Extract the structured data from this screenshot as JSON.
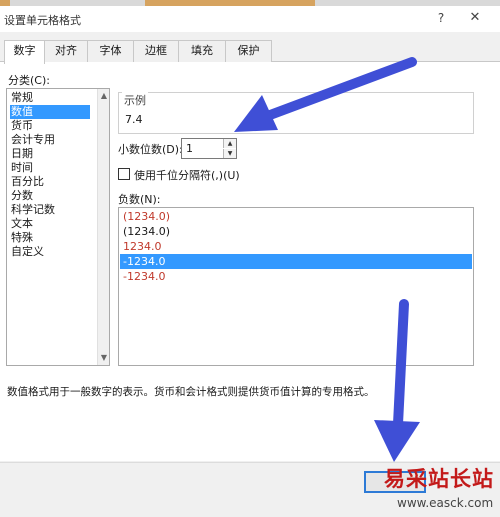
{
  "window": {
    "title": "设置单元格格式",
    "help": "?",
    "close": "✕"
  },
  "tabs": [
    {
      "label": "数字",
      "active": true
    },
    {
      "label": "对齐",
      "active": false
    },
    {
      "label": "字体",
      "active": false
    },
    {
      "label": "边框",
      "active": false
    },
    {
      "label": "填充",
      "active": false
    },
    {
      "label": "保护",
      "active": false
    }
  ],
  "category": {
    "label": "分类(C):",
    "items": [
      "常规",
      "数值",
      "货币",
      "会计专用",
      "日期",
      "时间",
      "百分比",
      "分数",
      "科学记数",
      "文本",
      "特殊",
      "自定义"
    ],
    "selected": "数值"
  },
  "sample": {
    "label": "示例",
    "value": "7.4"
  },
  "decimal": {
    "label": "小数位数(D):",
    "value": "1"
  },
  "separator": {
    "label": "使用千位分隔符(,)(U)",
    "checked": false
  },
  "negative": {
    "label": "负数(N):",
    "items": [
      {
        "text": "(1234.0)",
        "color": "#c0392b",
        "selected": false
      },
      {
        "text": "(1234.0)",
        "color": "#1a1a1a",
        "selected": false
      },
      {
        "text": "1234.0",
        "color": "#c0392b",
        "selected": false
      },
      {
        "text": "-1234.0",
        "color": "#1a1a1a",
        "selected": true
      },
      {
        "text": "-1234.0",
        "color": "#c0392b",
        "selected": false
      }
    ]
  },
  "description": "数值格式用于一般数字的表示。货币和会计格式则提供货币值计算的专用格式。",
  "watermark": {
    "brand": "易采站长站",
    "url": "www.easck.com"
  },
  "colors": {
    "selection": "#3399ff",
    "arrow": "#3f4fd6",
    "negative_red": "#c0392b",
    "watermark_red": "#c31a1a"
  }
}
